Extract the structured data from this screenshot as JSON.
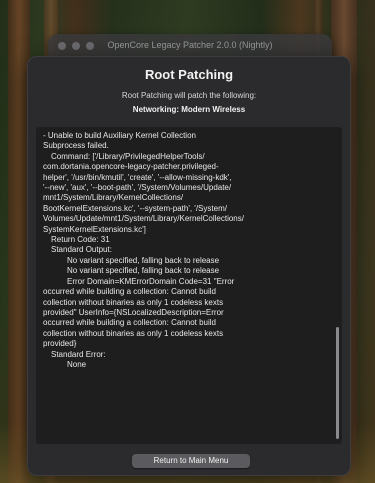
{
  "window": {
    "title": "OpenCore Legacy Patcher 2.0.0 (Nightly)"
  },
  "sheet": {
    "title": "Root Patching",
    "subtitle": "Root Patching will patch the following:",
    "target": "Networking: Modern Wireless"
  },
  "log": {
    "lines": [
      {
        "indent": 0,
        "text": "- Unable to build Auxiliary Kernel Collection"
      },
      {
        "indent": 0,
        "text": "Subprocess failed."
      },
      {
        "indent": 1,
        "text": "Command: ['/Library/PrivilegedHelperTools/"
      },
      {
        "indent": 0,
        "text": "com.dortania.opencore-legacy-patcher.privileged-"
      },
      {
        "indent": 0,
        "text": "helper', '/usr/bin/kmutil', 'create', '--allow-missing-kdk',"
      },
      {
        "indent": 0,
        "text": "'--new', 'aux', '--boot-path', '/System/Volumes/Update/"
      },
      {
        "indent": 0,
        "text": "mnt1/System/Library/KernelCollections/"
      },
      {
        "indent": 0,
        "text": "BootKernelExtensions.kc', '--system-path', '/System/"
      },
      {
        "indent": 0,
        "text": "Volumes/Update/mnt1/System/Library/KernelCollections/"
      },
      {
        "indent": 0,
        "text": "SystemKernelExtensions.kc']"
      },
      {
        "indent": 1,
        "text": "Return Code: 31"
      },
      {
        "indent": 1,
        "text": "Standard Output:"
      },
      {
        "indent": 3,
        "text": "No variant specified, falling back to release"
      },
      {
        "indent": 3,
        "text": "No variant specified, falling back to release"
      },
      {
        "indent": 3,
        "text": "Error Domain=KMErrorDomain Code=31 \"Error"
      },
      {
        "indent": 0,
        "text": "occurred while building a collection: Cannot build"
      },
      {
        "indent": 0,
        "text": "collection without binaries as only 1 codeless kexts"
      },
      {
        "indent": 0,
        "text": "provided\" UserInfo={NSLocalizedDescription=Error"
      },
      {
        "indent": 0,
        "text": "occurred while building a collection: Cannot build"
      },
      {
        "indent": 0,
        "text": "collection without binaries as only 1 codeless kexts"
      },
      {
        "indent": 0,
        "text": "provided}"
      },
      {
        "indent": 1,
        "text": "Standard Error:"
      },
      {
        "indent": 3,
        "text": "None"
      }
    ]
  },
  "buttons": {
    "return_main_menu": "Return to Main Menu"
  },
  "colors": {
    "sheet_bg": "#2b2b2d",
    "log_bg": "#1e1e1e",
    "button_bg": "#5b5b5f",
    "text": "#e8e8e8"
  }
}
